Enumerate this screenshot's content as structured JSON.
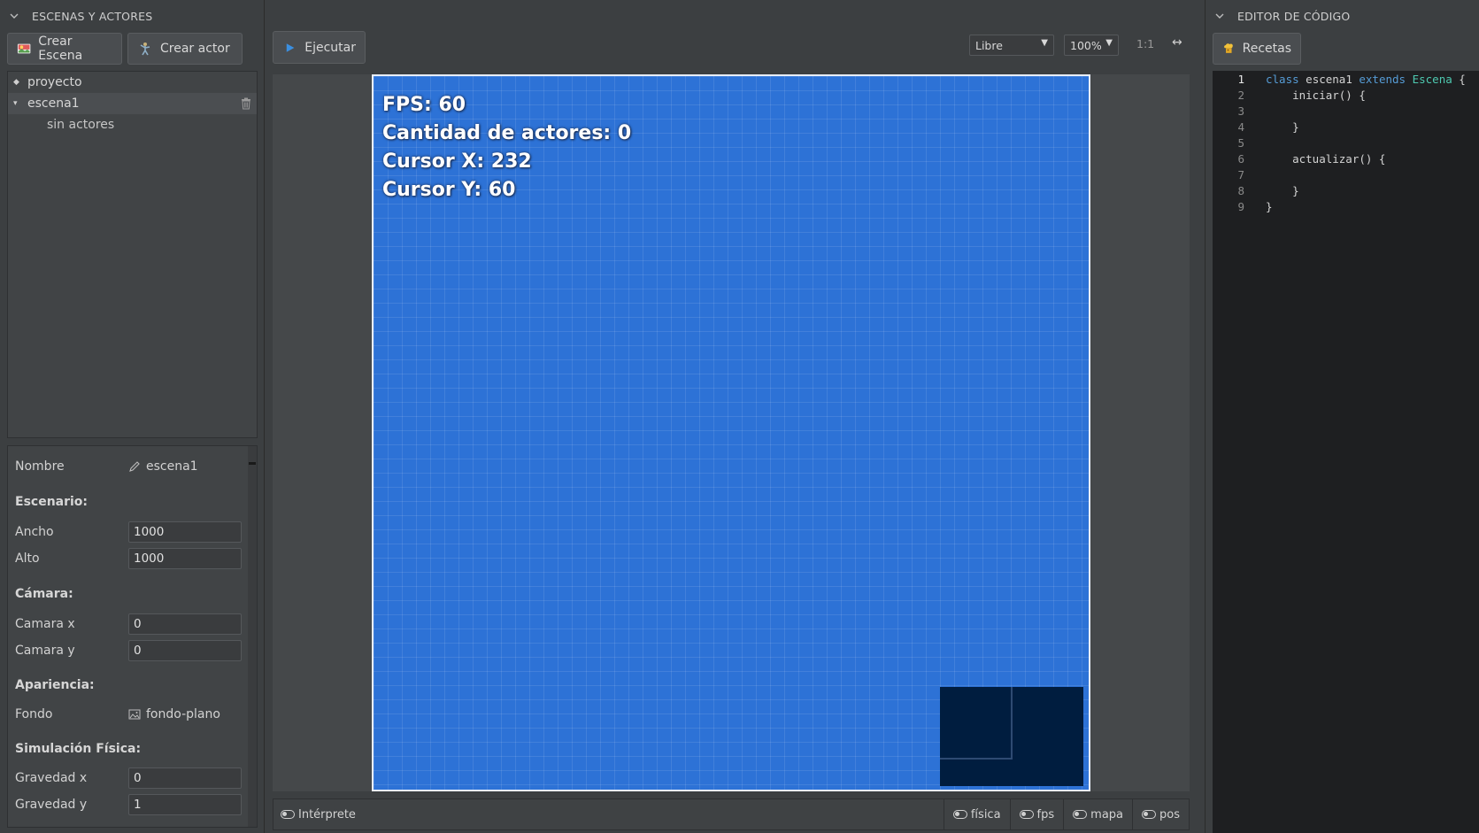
{
  "left_panel": {
    "header": "ESCENAS Y ACTORES",
    "buttons": {
      "create_scene": "Crear Escena",
      "create_actor": "Crear actor"
    },
    "tree": {
      "project": "proyecto",
      "scene": "escena1",
      "no_actors": "sin actores"
    },
    "props": {
      "name_label": "Nombre",
      "name_value": "escena1",
      "stage_section": "Escenario:",
      "width_label": "Ancho",
      "width_value": "1000",
      "height_label": "Alto",
      "height_value": "1000",
      "camera_section": "Cámara:",
      "camx_label": "Camara x",
      "camx_value": "0",
      "camy_label": "Camara y",
      "camy_value": "0",
      "appearance_section": "Apariencia:",
      "bg_label": "Fondo",
      "bg_value": "fondo-plano",
      "physics_section": "Simulación Física:",
      "gravx_label": "Gravedad x",
      "gravx_value": "0",
      "gravy_label": "Gravedad y",
      "gravy_value": "1"
    }
  },
  "center": {
    "run_label": "Ejecutar",
    "mode_select": "Libre",
    "zoom_select": "100%",
    "ratio_label": "1:1",
    "expand_glyph": "↔",
    "hud": {
      "fps": "FPS: 60",
      "actors": "Cantidad de actores: 0",
      "cursor_x": "Cursor X: 232",
      "cursor_y": "Cursor Y: 60"
    },
    "status": {
      "interpreter": "Intérprete",
      "physics": "física",
      "fps": "fps",
      "map": "mapa",
      "pos": "pos"
    }
  },
  "right_panel": {
    "header": "EDITOR DE CÓDIGO",
    "recipes_label": "Recetas",
    "code_lines": [
      {
        "n": "1"
      },
      {
        "n": "2",
        "text": "    iniciar() {"
      },
      {
        "n": "3",
        "text": ""
      },
      {
        "n": "4",
        "text": "    }"
      },
      {
        "n": "5",
        "text": ""
      },
      {
        "n": "6",
        "text": "    actualizar() {"
      },
      {
        "n": "7",
        "text": ""
      },
      {
        "n": "8",
        "text": "    }"
      },
      {
        "n": "9",
        "text": "}"
      }
    ],
    "line1": {
      "kw1": "class",
      "name": " escena1 ",
      "kw2": "extends",
      "base": " Escena",
      "brace": " {"
    }
  },
  "colors": {
    "canvas_bg": "#2d72d6",
    "minimap_bg": "#001d3f",
    "keyword": "#569cd6",
    "class_name": "#4ec9b0"
  }
}
